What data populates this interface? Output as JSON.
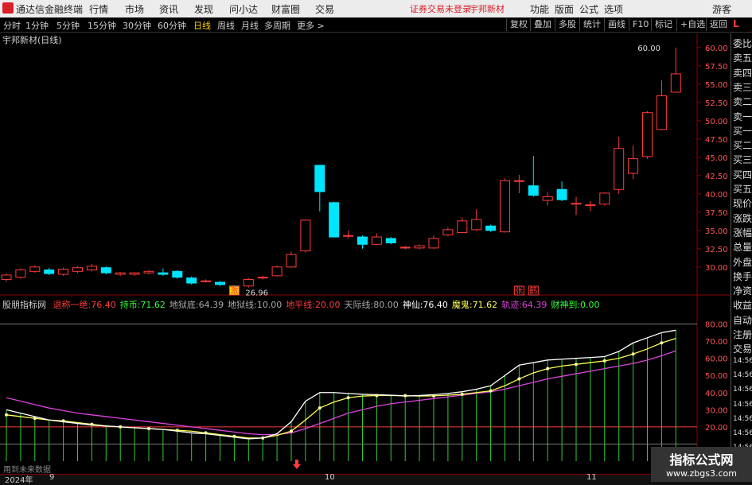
{
  "app": {
    "title": "通达信金融终端",
    "menus": [
      "行情",
      "市场",
      "资讯",
      "发现",
      "问小达",
      "财富圈",
      "交易"
    ],
    "warning": "证券交易未登录",
    "stock_name_top": "宇邦新材",
    "right_menus": [
      "功能",
      "版面",
      "公式",
      "选项"
    ],
    "user": "游客"
  },
  "toolbar": {
    "periods": [
      "分时",
      "1分钟",
      "5分钟",
      "15分钟",
      "30分钟",
      "60分钟",
      "日线",
      "周线",
      "月线",
      "多周期",
      "更多 >"
    ],
    "active_period": "日线",
    "tools": [
      "复权",
      "叠加",
      "多股",
      "统计",
      "画线",
      "F10",
      "标记",
      "+自选",
      "返回"
    ]
  },
  "chart_label": "宇邦新材(日线)",
  "sidebar": [
    "委比",
    "卖五",
    "卖四",
    "卖三",
    "卖二",
    "卖一",
    "买一",
    "买二",
    "买三",
    "买四",
    "买五",
    "现价",
    "涨跌",
    "涨幅",
    "总量",
    "外盘",
    "换手",
    "净资",
    "收益",
    "自动",
    "注册",
    "交易",
    "14:56",
    "14:56",
    "14:56",
    "14:56",
    "14:56",
    "14:56",
    "14:56"
  ],
  "price_axis": {
    "ticks": [
      "60.00",
      "57.50",
      "55.00",
      "52.50",
      "50.00",
      "47.50",
      "45.00",
      "42.50",
      "40.00",
      "37.50",
      "35.00",
      "32.50",
      "30.00"
    ],
    "max_label": "60.00",
    "min_label": "26.96"
  },
  "tags": [
    {
      "text": "激"
    },
    {
      "text": "张"
    },
    {
      "text": "鹤"
    }
  ],
  "indicator": {
    "name": "股朋指标网",
    "params": [
      {
        "label": "退称一绝:",
        "value": "76.40",
        "color": "#ff3b3b"
      },
      {
        "label": "持币:",
        "value": "71.62",
        "color": "#33ff33"
      },
      {
        "label": "地狱底:",
        "value": "64.39",
        "color": "#aaaaaa"
      },
      {
        "label": "地狱线:",
        "value": "10.00",
        "color": "#aaaaaa"
      },
      {
        "label": "地平线:",
        "value": "20.00",
        "color": "#ff3b3b"
      },
      {
        "label": "天际线:",
        "value": "80.00",
        "color": "#aaaaaa"
      },
      {
        "label": "神仙:",
        "value": "76.40",
        "color": "#ffffff"
      },
      {
        "label": "魔鬼:",
        "value": "71.62",
        "color": "#ffff55"
      },
      {
        "label": "轨迹:",
        "value": "64.39",
        "color": "#dd44dd"
      },
      {
        "label": "财神到:",
        "value": "0.00",
        "color": "#33ff33"
      }
    ],
    "axis": [
      "80.00",
      "70.00",
      "60.00",
      "50.00",
      "40.00",
      "30.00",
      "20.00"
    ]
  },
  "bottom": {
    "year": "2024年",
    "months": [
      "9",
      "10",
      "11"
    ],
    "note": "用到未来数据"
  },
  "watermark": {
    "line1": "指标公式网",
    "line2": "www.zbgs3.com"
  },
  "colors": {
    "up": "#ff3b3b",
    "down": "#00e5ff",
    "bg": "#000000"
  },
  "chart_data": {
    "type": "candlestick",
    "price_range": [
      26.5,
      61.5
    ],
    "candles": [
      {
        "o": 28.3,
        "c": 28.9,
        "h": 29.1,
        "l": 28.0
      },
      {
        "o": 28.6,
        "c": 29.6,
        "h": 29.8,
        "l": 28.4
      },
      {
        "o": 29.4,
        "c": 30.0,
        "h": 30.2,
        "l": 29.2
      },
      {
        "o": 29.6,
        "c": 29.1,
        "h": 29.9,
        "l": 28.9
      },
      {
        "o": 29.0,
        "c": 29.7,
        "h": 29.9,
        "l": 28.8
      },
      {
        "o": 29.4,
        "c": 29.9,
        "h": 30.1,
        "l": 29.2
      },
      {
        "o": 29.6,
        "c": 30.1,
        "h": 30.4,
        "l": 29.4
      },
      {
        "o": 29.9,
        "c": 29.2,
        "h": 30.1,
        "l": 29.0
      },
      {
        "o": 29.0,
        "c": 29.2,
        "h": 29.3,
        "l": 28.8
      },
      {
        "o": 29.0,
        "c": 29.2,
        "h": 29.3,
        "l": 28.8
      },
      {
        "o": 29.2,
        "c": 29.4,
        "h": 29.6,
        "l": 29.0
      },
      {
        "o": 29.2,
        "c": 29.0,
        "h": 29.8,
        "l": 28.8
      },
      {
        "o": 29.4,
        "c": 28.6,
        "h": 29.6,
        "l": 28.4
      },
      {
        "o": 28.5,
        "c": 27.8,
        "h": 28.7,
        "l": 27.6
      },
      {
        "o": 28.0,
        "c": 28.1,
        "h": 28.3,
        "l": 27.9
      },
      {
        "o": 27.9,
        "c": 27.6,
        "h": 28.1,
        "l": 27.4
      },
      {
        "o": 27.4,
        "c": 27.3,
        "h": 27.5,
        "l": 27.0
      },
      {
        "o": 27.4,
        "c": 28.3,
        "h": 28.5,
        "l": 27.2
      },
      {
        "o": 28.5,
        "c": 28.6,
        "h": 28.8,
        "l": 28.3
      },
      {
        "o": 28.8,
        "c": 30.0,
        "h": 30.2,
        "l": 28.7
      },
      {
        "o": 30.0,
        "c": 31.7,
        "h": 32.1,
        "l": 29.9
      },
      {
        "o": 32.2,
        "c": 36.4,
        "h": 36.5,
        "l": 32.0
      },
      {
        "o": 43.9,
        "c": 40.3,
        "h": 43.9,
        "l": 37.6
      },
      {
        "o": 38.8,
        "c": 34.1,
        "h": 38.9,
        "l": 34.1
      },
      {
        "o": 34.3,
        "c": 34.3,
        "h": 35.0,
        "l": 33.9
      },
      {
        "o": 34.1,
        "c": 33.1,
        "h": 34.3,
        "l": 32.5
      },
      {
        "o": 33.1,
        "c": 34.1,
        "h": 34.6,
        "l": 33.0
      },
      {
        "o": 33.9,
        "c": 33.3,
        "h": 34.1,
        "l": 33.1
      },
      {
        "o": 32.6,
        "c": 32.7,
        "h": 32.9,
        "l": 32.4
      },
      {
        "o": 32.6,
        "c": 32.9,
        "h": 33.1,
        "l": 32.4
      },
      {
        "o": 32.6,
        "c": 33.9,
        "h": 34.3,
        "l": 32.5
      },
      {
        "o": 34.4,
        "c": 35.1,
        "h": 35.4,
        "l": 34.2
      },
      {
        "o": 34.7,
        "c": 36.3,
        "h": 36.8,
        "l": 34.6
      },
      {
        "o": 35.1,
        "c": 36.5,
        "h": 37.9,
        "l": 34.9
      },
      {
        "o": 35.6,
        "c": 35.0,
        "h": 35.8,
        "l": 34.8
      },
      {
        "o": 34.8,
        "c": 41.8,
        "h": 42.1,
        "l": 34.7
      },
      {
        "o": 41.8,
        "c": 41.8,
        "h": 42.6,
        "l": 40.1
      },
      {
        "o": 41.1,
        "c": 39.8,
        "h": 45.2,
        "l": 39.6
      },
      {
        "o": 39.1,
        "c": 39.6,
        "h": 40.2,
        "l": 38.4
      },
      {
        "o": 40.6,
        "c": 39.2,
        "h": 41.7,
        "l": 39.0
      },
      {
        "o": 38.6,
        "c": 38.7,
        "h": 39.6,
        "l": 37.1
      },
      {
        "o": 38.4,
        "c": 38.5,
        "h": 39.0,
        "l": 37.6
      },
      {
        "o": 38.6,
        "c": 40.1,
        "h": 40.2,
        "l": 38.4
      },
      {
        "o": 40.6,
        "c": 46.2,
        "h": 47.8,
        "l": 40.0
      },
      {
        "o": 42.8,
        "c": 44.8,
        "h": 46.6,
        "l": 42.0
      },
      {
        "o": 45.1,
        "c": 51.1,
        "h": 51.3,
        "l": 44.8
      },
      {
        "o": 48.8,
        "c": 53.4,
        "h": 55.5,
        "l": 48.7
      },
      {
        "o": 53.9,
        "c": 56.4,
        "h": 60.0,
        "l": 53.8
      }
    ],
    "indicator_range": [
      0,
      90
    ],
    "shenxian": [
      30,
      28,
      26,
      24,
      23,
      22,
      21,
      20.5,
      20,
      19.5,
      19,
      18.5,
      17.5,
      16.5,
      16,
      15,
      14,
      13,
      13.5,
      16,
      23,
      35,
      40,
      40,
      39.5,
      39,
      38.8,
      38.5,
      38,
      38.3,
      38.8,
      39.5,
      40.5,
      42,
      44,
      50,
      56,
      57.5,
      59,
      59.5,
      60,
      60.5,
      61,
      64,
      69,
      72,
      75,
      76.4
    ],
    "mogui": [
      27,
      26,
      25,
      24,
      23.5,
      22.5,
      21.5,
      20.5,
      20,
      19.5,
      19,
      18.5,
      18,
      17.5,
      16.5,
      15.5,
      14.5,
      13.5,
      13.5,
      15,
      17.5,
      24,
      31,
      34.5,
      37,
      38,
      38.3,
      38.3,
      38.2,
      38,
      38.1,
      38.5,
      39,
      40,
      41,
      44,
      48,
      51.5,
      54,
      55.5,
      56.5,
      57.5,
      58.5,
      60,
      62.5,
      65.5,
      69,
      71.62
    ],
    "guiji": [
      37,
      35,
      33,
      31,
      29.5,
      28,
      27,
      26,
      25,
      24,
      23,
      22,
      21,
      20,
      19,
      18,
      17,
      16,
      15.5,
      15.5,
      16.5,
      19,
      22,
      25,
      28,
      30,
      32,
      33.5,
      34.5,
      35.5,
      36.5,
      37.5,
      38.5,
      39.5,
      40.5,
      42,
      44,
      46,
      48,
      49.5,
      51,
      52.5,
      54,
      55.5,
      57,
      59,
      61.5,
      64.39
    ]
  }
}
